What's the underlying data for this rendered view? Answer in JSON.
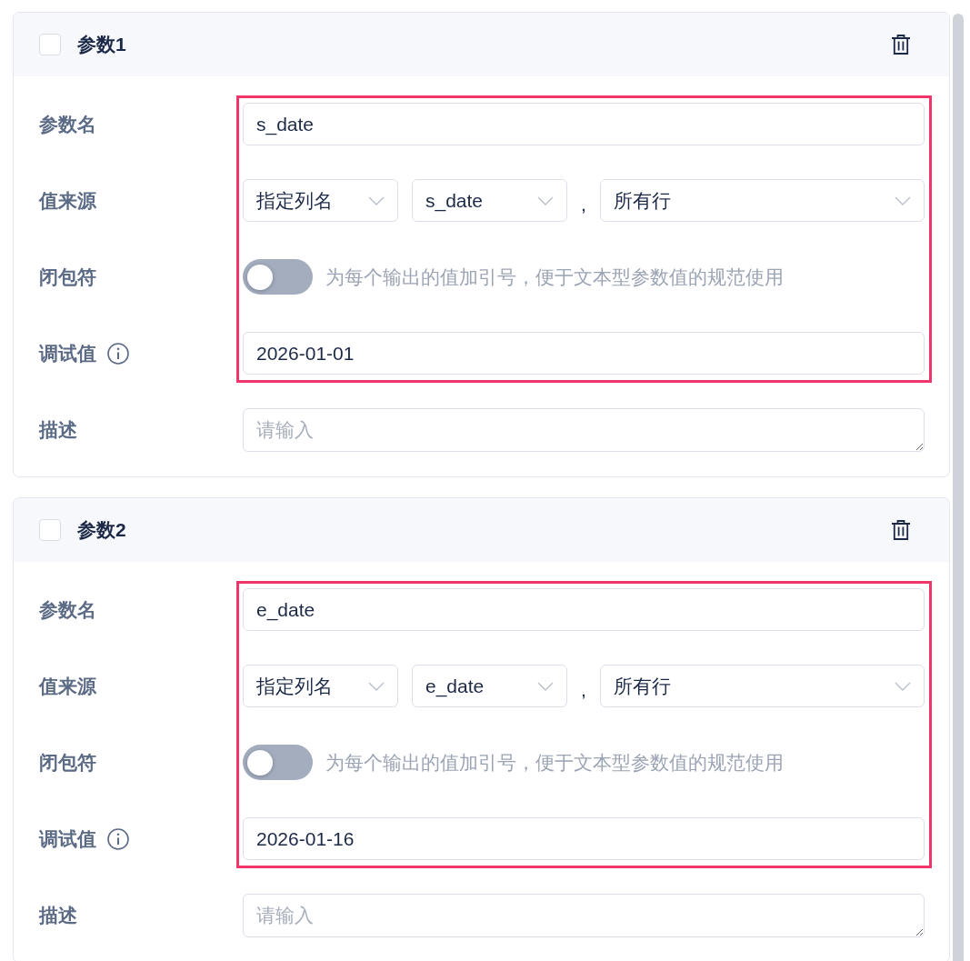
{
  "params": [
    {
      "title": "参数1",
      "checked": false,
      "fields": [
        {
          "kind": "text",
          "label": "参数名",
          "value": "s_date",
          "highlighted": true
        },
        {
          "kind": "source",
          "label": "值来源",
          "selects": [
            "指定列名",
            "s_date",
            "所有行"
          ],
          "separator": ",",
          "highlighted": true
        },
        {
          "kind": "toggle",
          "label": "闭包符",
          "on": false,
          "hint": "为每个输出的值加引号，便于文本型参数值的规范使用",
          "highlighted": true
        },
        {
          "kind": "text",
          "label": "调试值",
          "info": true,
          "value": "2026-01-01",
          "highlighted": true
        },
        {
          "kind": "textarea",
          "label": "描述",
          "placeholder": "请输入"
        }
      ]
    },
    {
      "title": "参数2",
      "checked": false,
      "fields": [
        {
          "kind": "text",
          "label": "参数名",
          "value": "e_date",
          "highlighted": true
        },
        {
          "kind": "source",
          "label": "值来源",
          "selects": [
            "指定列名",
            "e_date",
            "所有行"
          ],
          "separator": ",",
          "highlighted": true
        },
        {
          "kind": "toggle",
          "label": "闭包符",
          "on": false,
          "hint": "为每个输出的值加引号，便于文本型参数值的规范使用",
          "highlighted": true
        },
        {
          "kind": "text",
          "label": "调试值",
          "info": true,
          "value": "2026-01-16",
          "highlighted": true
        },
        {
          "kind": "textarea",
          "label": "描述",
          "placeholder": "请输入"
        }
      ]
    }
  ]
}
